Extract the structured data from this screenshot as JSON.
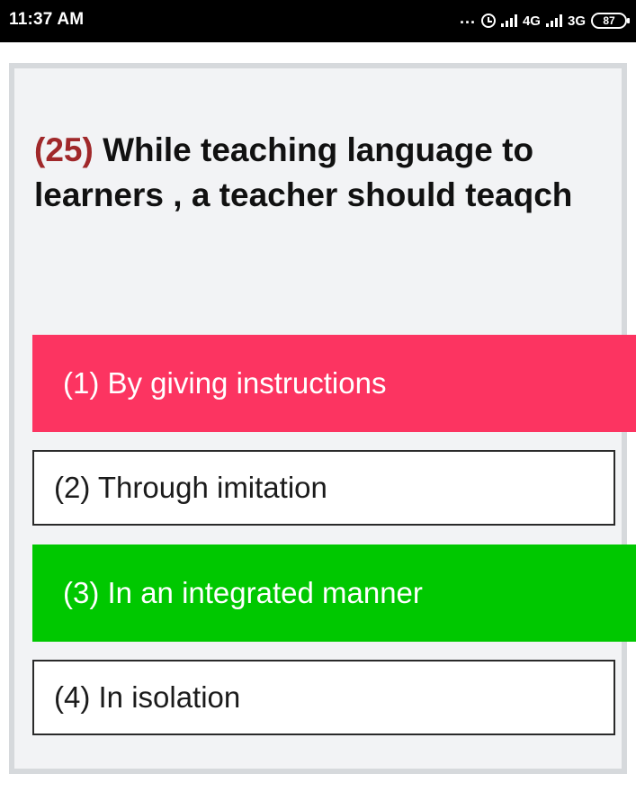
{
  "status_bar": {
    "time": "11:37 AM",
    "more_indicator": "...",
    "network_1": "4G",
    "network_2": "3G",
    "battery": "87"
  },
  "question": {
    "number": "(25)",
    "text": " While teaching language to learners , a teacher should teaqch"
  },
  "options": [
    {
      "label": "(1) By giving instructions",
      "state": "wrong",
      "color": "#fc3461"
    },
    {
      "label": "(2) Through imitation",
      "state": "neutral",
      "color": "#ffffff"
    },
    {
      "label": "(3) In an integrated manner",
      "state": "correct",
      "color": "#00c800"
    },
    {
      "label": "(4) In isolation",
      "state": "neutral",
      "color": "#ffffff"
    }
  ],
  "icons": [
    "alarm-icon",
    "signal-icon",
    "battery-icon"
  ]
}
